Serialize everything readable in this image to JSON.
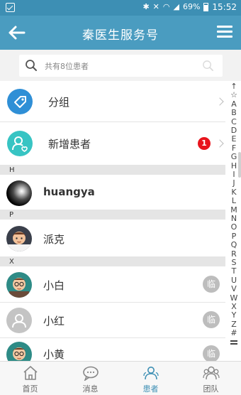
{
  "status_bar": {
    "battery": "69%",
    "time": "15:52"
  },
  "nav": {
    "title": "秦医生服务号"
  },
  "search": {
    "placeholder": "共有8位患者"
  },
  "actions": [
    {
      "label": "分组",
      "icon": "tag-icon",
      "color": "#2f8fd6"
    },
    {
      "label": "新增患者",
      "icon": "add-user-icon",
      "color": "#37c4c3",
      "badge": "1"
    }
  ],
  "sections": [
    {
      "letter": "H",
      "patients": [
        {
          "name": "huangya",
          "avatar": "black-circle-avatar"
        }
      ]
    },
    {
      "letter": "P",
      "patients": [
        {
          "name": "派克",
          "avatar": "cartoon-man-avatar"
        }
      ]
    },
    {
      "letter": "X",
      "patients": [
        {
          "name": "小白",
          "avatar": "cartoon-glasses-avatar",
          "tag": "临"
        },
        {
          "name": "小红",
          "avatar": "default-user-avatar",
          "tag": "临"
        },
        {
          "name": "小黄",
          "avatar": "cartoon-glasses-avatar",
          "tag": "临"
        }
      ]
    }
  ],
  "index_letters": [
    "↑",
    "☆",
    "A",
    "B",
    "C",
    "D",
    "E",
    "F",
    "G",
    "H",
    "I",
    "J",
    "K",
    "L",
    "M",
    "N",
    "O",
    "P",
    "Q",
    "R",
    "S",
    "T",
    "U",
    "V",
    "W",
    "X",
    "Y",
    "Z",
    "#"
  ],
  "tabs": [
    {
      "label": "首页",
      "icon": "home-icon",
      "active": false
    },
    {
      "label": "消息",
      "icon": "chat-icon",
      "active": false
    },
    {
      "label": "患者",
      "icon": "patients-icon",
      "active": true
    },
    {
      "label": "团队",
      "icon": "team-icon",
      "active": false
    }
  ],
  "colors": {
    "primary": "#4a9cc0",
    "status_bar": "#3d8fb4",
    "badge": "#e8141c",
    "tag": "#bdbdbd"
  }
}
